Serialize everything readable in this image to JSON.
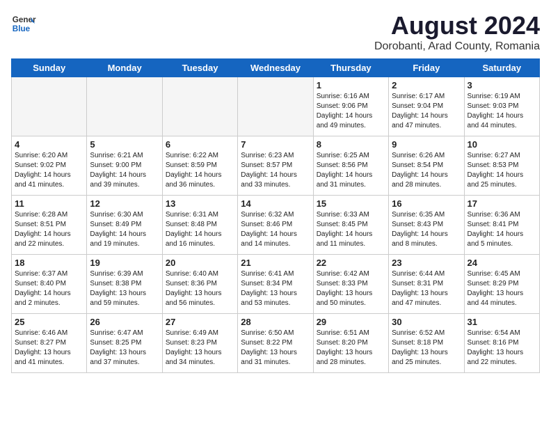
{
  "header": {
    "logo_general": "General",
    "logo_blue": "Blue",
    "month_title": "August 2024",
    "location": "Dorobanti, Arad County, Romania"
  },
  "weekdays": [
    "Sunday",
    "Monday",
    "Tuesday",
    "Wednesday",
    "Thursday",
    "Friday",
    "Saturday"
  ],
  "weeks": [
    [
      {
        "day": "",
        "info": ""
      },
      {
        "day": "",
        "info": ""
      },
      {
        "day": "",
        "info": ""
      },
      {
        "day": "",
        "info": ""
      },
      {
        "day": "1",
        "info": "Sunrise: 6:16 AM\nSunset: 9:06 PM\nDaylight: 14 hours\nand 49 minutes."
      },
      {
        "day": "2",
        "info": "Sunrise: 6:17 AM\nSunset: 9:04 PM\nDaylight: 14 hours\nand 47 minutes."
      },
      {
        "day": "3",
        "info": "Sunrise: 6:19 AM\nSunset: 9:03 PM\nDaylight: 14 hours\nand 44 minutes."
      }
    ],
    [
      {
        "day": "4",
        "info": "Sunrise: 6:20 AM\nSunset: 9:02 PM\nDaylight: 14 hours\nand 41 minutes."
      },
      {
        "day": "5",
        "info": "Sunrise: 6:21 AM\nSunset: 9:00 PM\nDaylight: 14 hours\nand 39 minutes."
      },
      {
        "day": "6",
        "info": "Sunrise: 6:22 AM\nSunset: 8:59 PM\nDaylight: 14 hours\nand 36 minutes."
      },
      {
        "day": "7",
        "info": "Sunrise: 6:23 AM\nSunset: 8:57 PM\nDaylight: 14 hours\nand 33 minutes."
      },
      {
        "day": "8",
        "info": "Sunrise: 6:25 AM\nSunset: 8:56 PM\nDaylight: 14 hours\nand 31 minutes."
      },
      {
        "day": "9",
        "info": "Sunrise: 6:26 AM\nSunset: 8:54 PM\nDaylight: 14 hours\nand 28 minutes."
      },
      {
        "day": "10",
        "info": "Sunrise: 6:27 AM\nSunset: 8:53 PM\nDaylight: 14 hours\nand 25 minutes."
      }
    ],
    [
      {
        "day": "11",
        "info": "Sunrise: 6:28 AM\nSunset: 8:51 PM\nDaylight: 14 hours\nand 22 minutes."
      },
      {
        "day": "12",
        "info": "Sunrise: 6:30 AM\nSunset: 8:49 PM\nDaylight: 14 hours\nand 19 minutes."
      },
      {
        "day": "13",
        "info": "Sunrise: 6:31 AM\nSunset: 8:48 PM\nDaylight: 14 hours\nand 16 minutes."
      },
      {
        "day": "14",
        "info": "Sunrise: 6:32 AM\nSunset: 8:46 PM\nDaylight: 14 hours\nand 14 minutes."
      },
      {
        "day": "15",
        "info": "Sunrise: 6:33 AM\nSunset: 8:45 PM\nDaylight: 14 hours\nand 11 minutes."
      },
      {
        "day": "16",
        "info": "Sunrise: 6:35 AM\nSunset: 8:43 PM\nDaylight: 14 hours\nand 8 minutes."
      },
      {
        "day": "17",
        "info": "Sunrise: 6:36 AM\nSunset: 8:41 PM\nDaylight: 14 hours\nand 5 minutes."
      }
    ],
    [
      {
        "day": "18",
        "info": "Sunrise: 6:37 AM\nSunset: 8:40 PM\nDaylight: 14 hours\nand 2 minutes."
      },
      {
        "day": "19",
        "info": "Sunrise: 6:39 AM\nSunset: 8:38 PM\nDaylight: 13 hours\nand 59 minutes."
      },
      {
        "day": "20",
        "info": "Sunrise: 6:40 AM\nSunset: 8:36 PM\nDaylight: 13 hours\nand 56 minutes."
      },
      {
        "day": "21",
        "info": "Sunrise: 6:41 AM\nSunset: 8:34 PM\nDaylight: 13 hours\nand 53 minutes."
      },
      {
        "day": "22",
        "info": "Sunrise: 6:42 AM\nSunset: 8:33 PM\nDaylight: 13 hours\nand 50 minutes."
      },
      {
        "day": "23",
        "info": "Sunrise: 6:44 AM\nSunset: 8:31 PM\nDaylight: 13 hours\nand 47 minutes."
      },
      {
        "day": "24",
        "info": "Sunrise: 6:45 AM\nSunset: 8:29 PM\nDaylight: 13 hours\nand 44 minutes."
      }
    ],
    [
      {
        "day": "25",
        "info": "Sunrise: 6:46 AM\nSunset: 8:27 PM\nDaylight: 13 hours\nand 41 minutes."
      },
      {
        "day": "26",
        "info": "Sunrise: 6:47 AM\nSunset: 8:25 PM\nDaylight: 13 hours\nand 37 minutes."
      },
      {
        "day": "27",
        "info": "Sunrise: 6:49 AM\nSunset: 8:23 PM\nDaylight: 13 hours\nand 34 minutes."
      },
      {
        "day": "28",
        "info": "Sunrise: 6:50 AM\nSunset: 8:22 PM\nDaylight: 13 hours\nand 31 minutes."
      },
      {
        "day": "29",
        "info": "Sunrise: 6:51 AM\nSunset: 8:20 PM\nDaylight: 13 hours\nand 28 minutes."
      },
      {
        "day": "30",
        "info": "Sunrise: 6:52 AM\nSunset: 8:18 PM\nDaylight: 13 hours\nand 25 minutes."
      },
      {
        "day": "31",
        "info": "Sunrise: 6:54 AM\nSunset: 8:16 PM\nDaylight: 13 hours\nand 22 minutes."
      }
    ]
  ]
}
